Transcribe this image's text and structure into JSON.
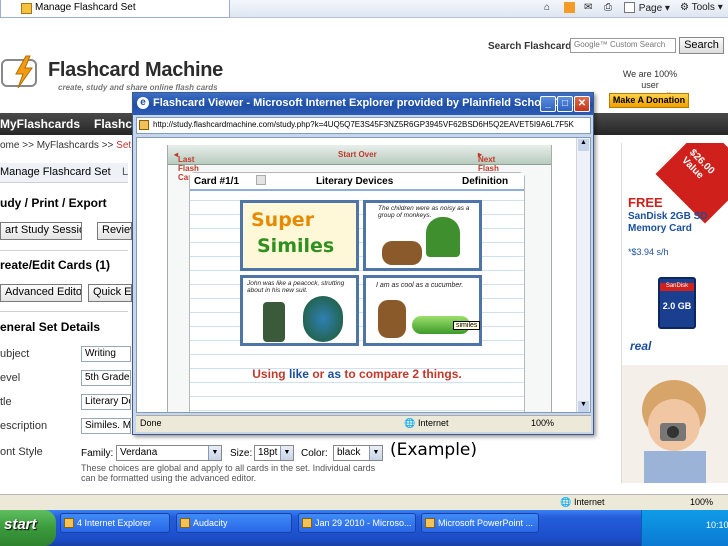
{
  "browser": {
    "tab_title": "Manage Flashcard Set",
    "commands": {
      "page": "Page",
      "tools": "Tools"
    }
  },
  "header": {
    "title": "Flashcard Machine",
    "tagline": "create, study and share online flash cards",
    "search_label": "Search Flashcards:",
    "search_placeholder": "Google™ Custom Search",
    "search_button": "Search",
    "support_text": "We are 100% user supported!",
    "donate_button": "Make A Donation"
  },
  "nav": {
    "myflashcards": "MyFlashcards",
    "flashcards_partial": "Flashca"
  },
  "breadcrumb": {
    "home_part": "ome >> MyFlashcards >>",
    "current": "Set Details",
    "page_title": "Manage Flashcard Set",
    "tab_partial": "L"
  },
  "left_panel": {
    "study_header": "udy / Print / Export",
    "study_button": "art Study Session",
    "review_button": "Review",
    "create_header": "reate/Edit Cards (1)",
    "advanced_editor_button": "Advanced Editor",
    "quick_editor_button": "Quick Ec",
    "general_header": "eneral Set Details",
    "fields": [
      {
        "label": "ubject",
        "value": "Writing"
      },
      {
        "label": "evel",
        "value": "5th Grade"
      },
      {
        "label": "tle",
        "value": "Literary De"
      },
      {
        "label": "escription",
        "value": "Similes. M"
      },
      {
        "label": "ont Style",
        "value": ""
      }
    ]
  },
  "font_row": {
    "family_label": "Family:",
    "family_value": "Verdana",
    "size_label": "Size:",
    "size_value": "18pt",
    "color_label": "Color:",
    "color_value": "black",
    "example": "(Example)",
    "note": "These choices are global and apply to all cards in the set. Individual cards can be formatted using the advanced editor."
  },
  "ad": {
    "price_tag": "$26.00 Value",
    "free": "FREE",
    "product": "SanDisk 2GB SD Memory Card",
    "shipping": "*$3.94 s/h",
    "card_capacity": "2.0 GB",
    "card_brand": "SanDisk",
    "sponsor": "real"
  },
  "popup": {
    "title": "Flashcard Viewer - Microsoft Internet Explorer provided by Plainfield School Dis...",
    "address": "http://study.flashcardmachine.com/study.php?k=4UQ5Q7E3S45F3NZ5R6GP3945VF62BSD6H5Q2EAVET5I9A6L7F5K",
    "nav_last": "Last Flash Card",
    "nav_start_over": "Start Over",
    "nav_next": "Next Flash Card",
    "card_number": "Card #1/1",
    "card_title": "Literary Devices",
    "card_side": "Definition",
    "image_title_1": "Super",
    "image_title_2": "Similes",
    "quote_1": "The children were as noisy as a group of monkeys.",
    "quote_2": "John was like a peacock, strutting about in his new suit.",
    "quote_3": "I am as cool as a cucumber.",
    "tooltip": "similes",
    "tagline": {
      "w1": "Using",
      "w2": "like",
      "w3": "or",
      "w4": "as",
      "w5": "to compare 2 things."
    },
    "status_done": "Done",
    "status_zone": "Internet",
    "status_zoom": "100%"
  },
  "ie_status": {
    "zone": "Internet",
    "zoom": "100%"
  },
  "taskbar": {
    "start": "start",
    "tasks": [
      "4 Internet Explorer",
      "Audacity",
      "Jan 29 2010 - Microso...",
      "Microsoft PowerPoint ..."
    ],
    "clock": "10:10"
  },
  "colors": {
    "title_bar": "#1f4fa5",
    "nav_bar": "#262626",
    "accent_red": "#c0392b",
    "taskbar": "#245edb"
  }
}
